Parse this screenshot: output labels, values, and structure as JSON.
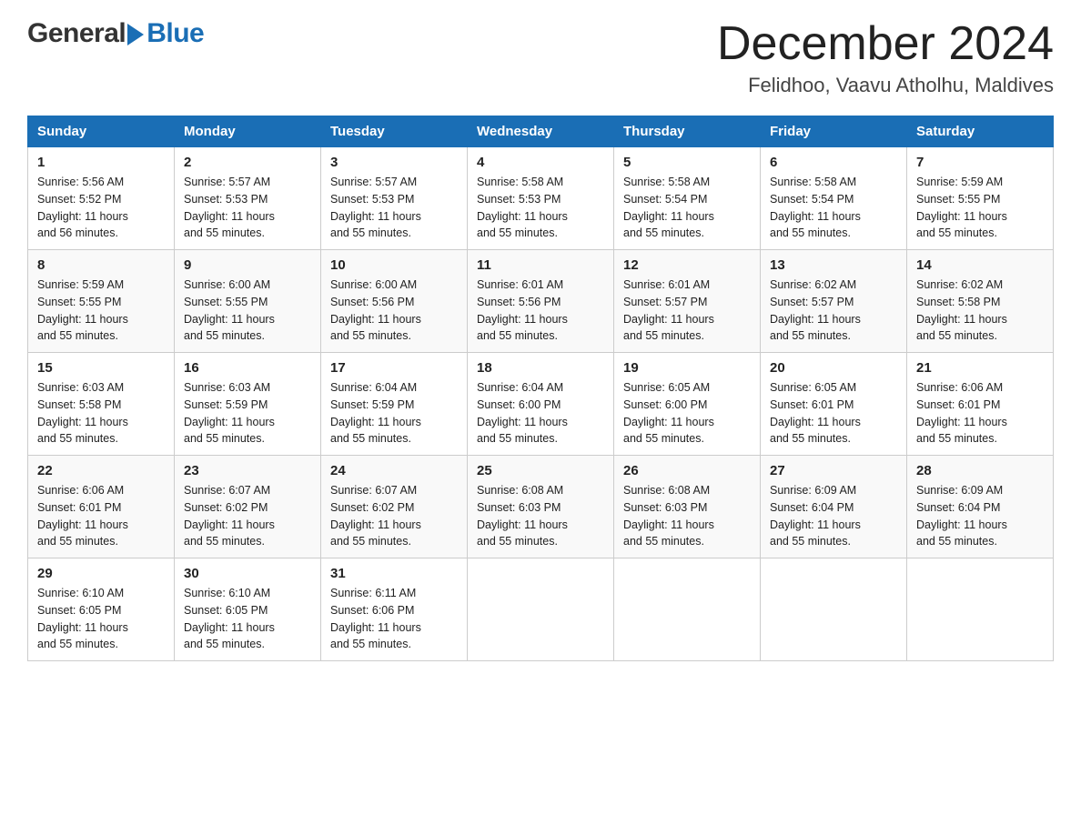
{
  "header": {
    "logo": {
      "general": "General",
      "blue": "Blue"
    },
    "title": "December 2024",
    "location": "Felidhoo, Vaavu Atholhu, Maldives"
  },
  "calendar": {
    "days_of_week": [
      "Sunday",
      "Monday",
      "Tuesday",
      "Wednesday",
      "Thursday",
      "Friday",
      "Saturday"
    ],
    "weeks": [
      [
        {
          "day": "1",
          "sunrise": "5:56 AM",
          "sunset": "5:52 PM",
          "daylight": "11 hours and 56 minutes."
        },
        {
          "day": "2",
          "sunrise": "5:57 AM",
          "sunset": "5:53 PM",
          "daylight": "11 hours and 55 minutes."
        },
        {
          "day": "3",
          "sunrise": "5:57 AM",
          "sunset": "5:53 PM",
          "daylight": "11 hours and 55 minutes."
        },
        {
          "day": "4",
          "sunrise": "5:58 AM",
          "sunset": "5:53 PM",
          "daylight": "11 hours and 55 minutes."
        },
        {
          "day": "5",
          "sunrise": "5:58 AM",
          "sunset": "5:54 PM",
          "daylight": "11 hours and 55 minutes."
        },
        {
          "day": "6",
          "sunrise": "5:58 AM",
          "sunset": "5:54 PM",
          "daylight": "11 hours and 55 minutes."
        },
        {
          "day": "7",
          "sunrise": "5:59 AM",
          "sunset": "5:55 PM",
          "daylight": "11 hours and 55 minutes."
        }
      ],
      [
        {
          "day": "8",
          "sunrise": "5:59 AM",
          "sunset": "5:55 PM",
          "daylight": "11 hours and 55 minutes."
        },
        {
          "day": "9",
          "sunrise": "6:00 AM",
          "sunset": "5:55 PM",
          "daylight": "11 hours and 55 minutes."
        },
        {
          "day": "10",
          "sunrise": "6:00 AM",
          "sunset": "5:56 PM",
          "daylight": "11 hours and 55 minutes."
        },
        {
          "day": "11",
          "sunrise": "6:01 AM",
          "sunset": "5:56 PM",
          "daylight": "11 hours and 55 minutes."
        },
        {
          "day": "12",
          "sunrise": "6:01 AM",
          "sunset": "5:57 PM",
          "daylight": "11 hours and 55 minutes."
        },
        {
          "day": "13",
          "sunrise": "6:02 AM",
          "sunset": "5:57 PM",
          "daylight": "11 hours and 55 minutes."
        },
        {
          "day": "14",
          "sunrise": "6:02 AM",
          "sunset": "5:58 PM",
          "daylight": "11 hours and 55 minutes."
        }
      ],
      [
        {
          "day": "15",
          "sunrise": "6:03 AM",
          "sunset": "5:58 PM",
          "daylight": "11 hours and 55 minutes."
        },
        {
          "day": "16",
          "sunrise": "6:03 AM",
          "sunset": "5:59 PM",
          "daylight": "11 hours and 55 minutes."
        },
        {
          "day": "17",
          "sunrise": "6:04 AM",
          "sunset": "5:59 PM",
          "daylight": "11 hours and 55 minutes."
        },
        {
          "day": "18",
          "sunrise": "6:04 AM",
          "sunset": "6:00 PM",
          "daylight": "11 hours and 55 minutes."
        },
        {
          "day": "19",
          "sunrise": "6:05 AM",
          "sunset": "6:00 PM",
          "daylight": "11 hours and 55 minutes."
        },
        {
          "day": "20",
          "sunrise": "6:05 AM",
          "sunset": "6:01 PM",
          "daylight": "11 hours and 55 minutes."
        },
        {
          "day": "21",
          "sunrise": "6:06 AM",
          "sunset": "6:01 PM",
          "daylight": "11 hours and 55 minutes."
        }
      ],
      [
        {
          "day": "22",
          "sunrise": "6:06 AM",
          "sunset": "6:01 PM",
          "daylight": "11 hours and 55 minutes."
        },
        {
          "day": "23",
          "sunrise": "6:07 AM",
          "sunset": "6:02 PM",
          "daylight": "11 hours and 55 minutes."
        },
        {
          "day": "24",
          "sunrise": "6:07 AM",
          "sunset": "6:02 PM",
          "daylight": "11 hours and 55 minutes."
        },
        {
          "day": "25",
          "sunrise": "6:08 AM",
          "sunset": "6:03 PM",
          "daylight": "11 hours and 55 minutes."
        },
        {
          "day": "26",
          "sunrise": "6:08 AM",
          "sunset": "6:03 PM",
          "daylight": "11 hours and 55 minutes."
        },
        {
          "day": "27",
          "sunrise": "6:09 AM",
          "sunset": "6:04 PM",
          "daylight": "11 hours and 55 minutes."
        },
        {
          "day": "28",
          "sunrise": "6:09 AM",
          "sunset": "6:04 PM",
          "daylight": "11 hours and 55 minutes."
        }
      ],
      [
        {
          "day": "29",
          "sunrise": "6:10 AM",
          "sunset": "6:05 PM",
          "daylight": "11 hours and 55 minutes."
        },
        {
          "day": "30",
          "sunrise": "6:10 AM",
          "sunset": "6:05 PM",
          "daylight": "11 hours and 55 minutes."
        },
        {
          "day": "31",
          "sunrise": "6:11 AM",
          "sunset": "6:06 PM",
          "daylight": "11 hours and 55 minutes."
        },
        null,
        null,
        null,
        null
      ]
    ],
    "sunrise_label": "Sunrise:",
    "sunset_label": "Sunset:",
    "daylight_label": "Daylight:"
  }
}
